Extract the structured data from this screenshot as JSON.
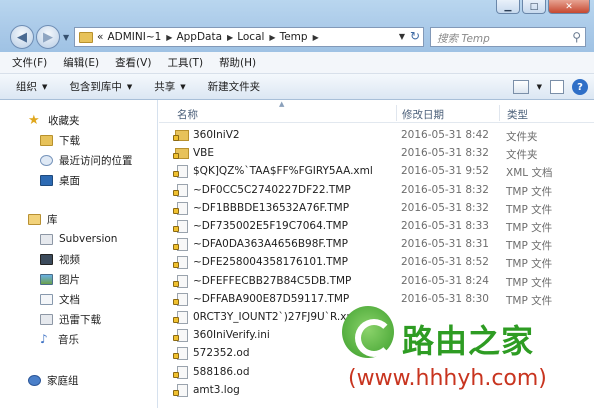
{
  "address": {
    "prefix": "«",
    "crumbs": [
      "ADMINI~1",
      "AppData",
      "Local",
      "Temp"
    ]
  },
  "search": {
    "placeholder": "搜索 Temp"
  },
  "menu": [
    "文件(F)",
    "编辑(E)",
    "查看(V)",
    "工具(T)",
    "帮助(H)"
  ],
  "toolbar": {
    "organize": "组织",
    "include": "包含到库中",
    "share": "共享",
    "new_folder": "新建文件夹"
  },
  "sidebar": {
    "favorites": "收藏夹",
    "downloads": "下载",
    "recent": "最近访问的位置",
    "desktop": "桌面",
    "libraries": "库",
    "subversion": "Subversion",
    "videos": "视频",
    "pictures": "图片",
    "documents": "文档",
    "thunder": "迅雷下载",
    "music": "音乐",
    "homegroup": "家庭组"
  },
  "columns": {
    "name": "名称",
    "date": "修改日期",
    "type": "类型"
  },
  "files": [
    {
      "name": "360IniV2",
      "date": "2016-05-31 8:42",
      "type": "文件夹",
      "kind": "folder"
    },
    {
      "name": "VBE",
      "date": "2016-05-31 8:32",
      "type": "文件夹",
      "kind": "folder"
    },
    {
      "name": "$QK]QZ%`TAA$FF%FGIRY5AA.xml",
      "date": "2016-05-31 9:52",
      "type": "XML 文档",
      "kind": "file"
    },
    {
      "name": "~DF0CC5C2740227DF22.TMP",
      "date": "2016-05-31 8:32",
      "type": "TMP 文件",
      "kind": "file"
    },
    {
      "name": "~DF1BBBDE136532A76F.TMP",
      "date": "2016-05-31 8:32",
      "type": "TMP 文件",
      "kind": "file"
    },
    {
      "name": "~DF735002E5F19C7064.TMP",
      "date": "2016-05-31 8:33",
      "type": "TMP 文件",
      "kind": "file"
    },
    {
      "name": "~DFA0DA363A4656B98F.TMP",
      "date": "2016-05-31 8:31",
      "type": "TMP 文件",
      "kind": "file"
    },
    {
      "name": "~DFE258004358176101.TMP",
      "date": "2016-05-31 8:52",
      "type": "TMP 文件",
      "kind": "file"
    },
    {
      "name": "~DFEFFECBB27B84C5DB.TMP",
      "date": "2016-05-31 8:24",
      "type": "TMP 文件",
      "kind": "file"
    },
    {
      "name": "~DFFABA900E87D59117.TMP",
      "date": "2016-05-31 8:30",
      "type": "TMP 文件",
      "kind": "file"
    },
    {
      "name": "0RCT3Y_IOUNT2`)27FJ9U`R.xml",
      "date": "",
      "type": "",
      "kind": "file"
    },
    {
      "name": "360IniVerify.ini",
      "date": "",
      "type": "",
      "kind": "file"
    },
    {
      "name": "572352.od",
      "date": "",
      "type": "",
      "kind": "file"
    },
    {
      "name": "588186.od",
      "date": "",
      "type": "",
      "kind": "file"
    },
    {
      "name": "amt3.log",
      "date": "",
      "type": "",
      "kind": "file"
    }
  ],
  "watermark": {
    "cn": "路由之家",
    "url": "(www.hhhyh.com)"
  }
}
